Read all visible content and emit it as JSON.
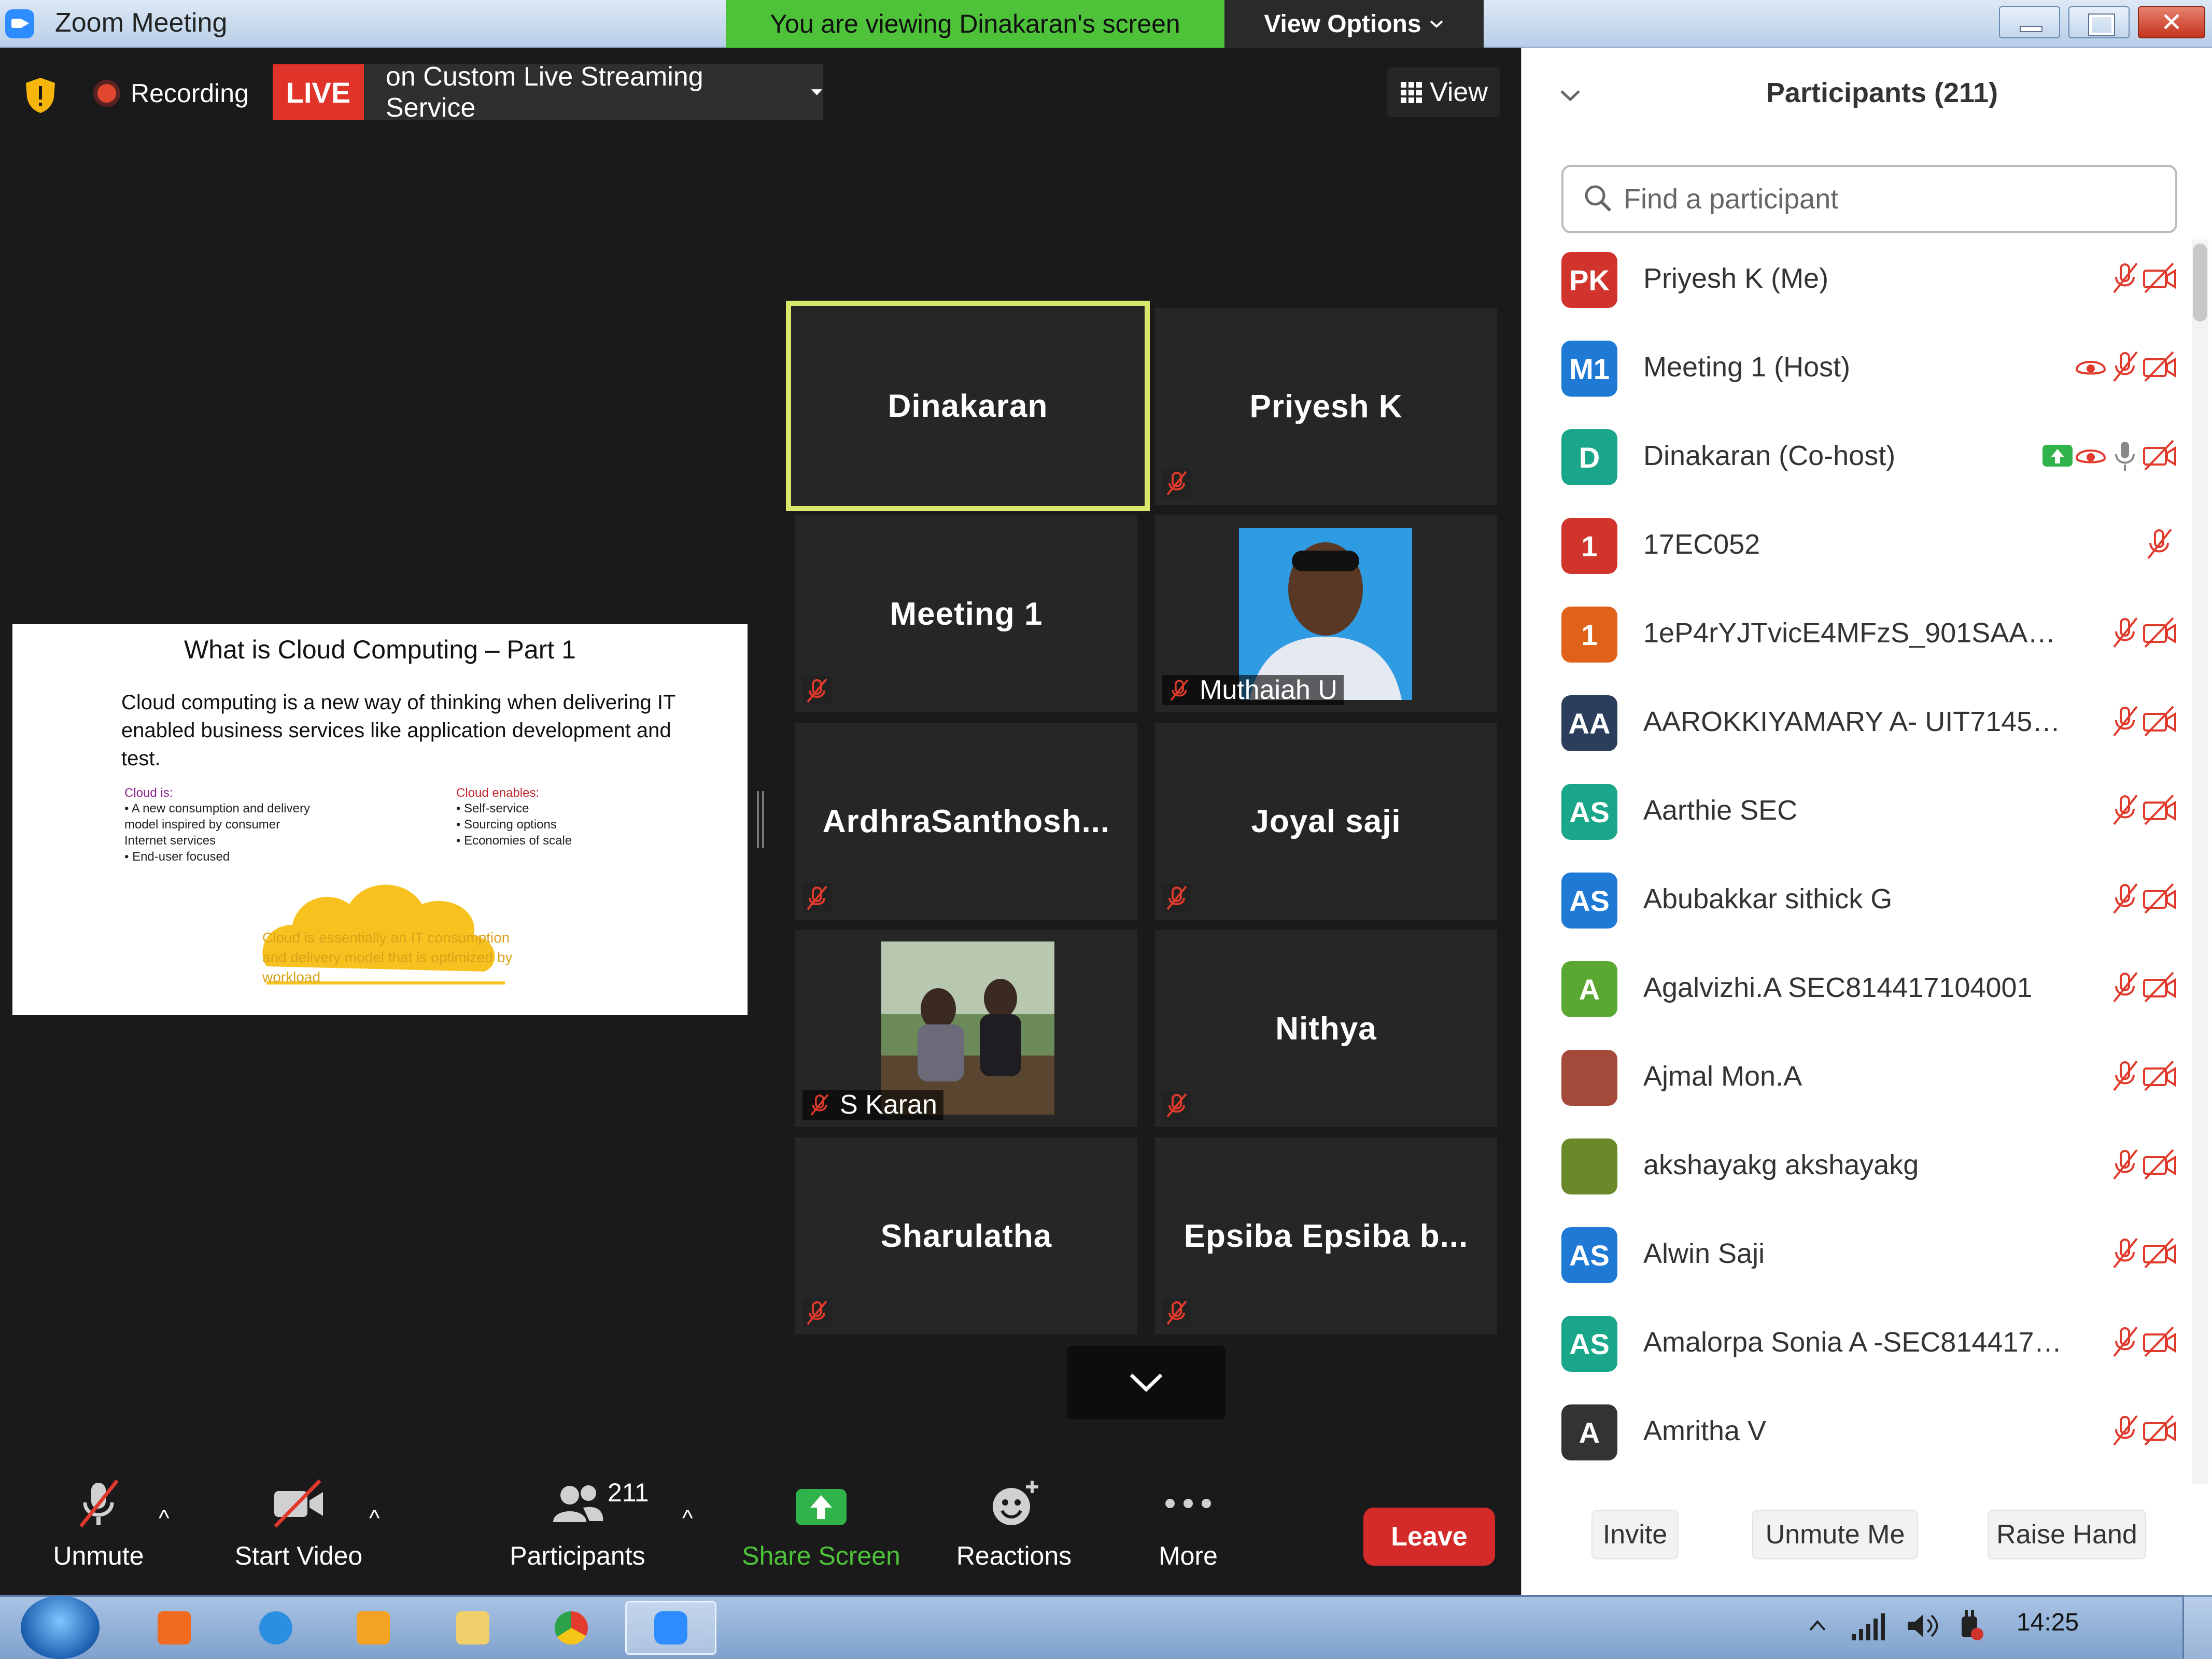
{
  "window": {
    "title": "Zoom Meeting"
  },
  "banner": {
    "viewing_text": "You are viewing Dinakaran's screen",
    "view_options": "View Options"
  },
  "meeting_top": {
    "recording_label": "Recording",
    "live_badge": "LIVE",
    "stream_service": "on Custom Live Streaming Service",
    "view_label": "View"
  },
  "shared_slide": {
    "title": "What is Cloud Computing – Part 1",
    "body": "Cloud computing is a new way of thinking when delivering IT enabled business services like application development and test.",
    "left_heading": "Cloud is:",
    "left_items": [
      "A new consumption and delivery model inspired by consumer Internet services",
      "End-user focused"
    ],
    "right_heading": "Cloud enables:",
    "right_items": [
      "Self-service",
      "Sourcing options",
      "Economies of scale"
    ],
    "cloud_caption": "Cloud is essentially an IT consumption and delivery model that is optimized by workload"
  },
  "gallery": {
    "tiles": [
      {
        "name": "Dinakaran",
        "active_speaker": true,
        "muted": false
      },
      {
        "name": "Priyesh K",
        "muted": true
      },
      {
        "name": "Meeting 1",
        "muted": true
      },
      {
        "name": "Muthaiah U",
        "muted": true,
        "video": true
      },
      {
        "name": "ArdhraSanthosh...",
        "muted": true
      },
      {
        "name": "Joyal saji",
        "muted": true
      },
      {
        "name": "S Karan",
        "muted": true,
        "video": true
      },
      {
        "name": "Nithya",
        "muted": true
      },
      {
        "name": "Sharulatha",
        "muted": true
      },
      {
        "name": "Epsiba  Epsiba  b...",
        "muted": true
      }
    ]
  },
  "toolbar": {
    "unmute": "Unmute",
    "start_video": "Start Video",
    "participants": "Participants",
    "participant_count": "211",
    "share_screen": "Share Screen",
    "reactions": "Reactions",
    "more": "More",
    "leave": "Leave"
  },
  "panel": {
    "title": "Participants (211)",
    "search_placeholder": "Find a participant",
    "participants": [
      {
        "initials": "PK",
        "name": "Priyesh K (Me)",
        "color": "#d0342c"
      },
      {
        "initials": "M1",
        "name": "Meeting 1 (Host)",
        "color": "#1f7ad6"
      },
      {
        "initials": "D",
        "name": "Dinakaran (Co-host)",
        "color": "#1aa68a"
      },
      {
        "initials": "1",
        "name": "17EC052",
        "color": "#d0342c"
      },
      {
        "initials": "1",
        "name": "1eP4rYJTvicE4MFzS_901SAAAAA...",
        "color": "#e0611a"
      },
      {
        "initials": "AA",
        "name": "AAROKKIYAMARY A- UIT714517...",
        "color": "#2b3f5c"
      },
      {
        "initials": "AS",
        "name": "Aarthie SEC",
        "color": "#1aa68a"
      },
      {
        "initials": "AS",
        "name": "Abubakkar sithick G",
        "color": "#1f7ad6"
      },
      {
        "initials": "A",
        "name": "Agalvizhi.A SEC814417104001",
        "color": "#5aa832"
      },
      {
        "initials": "",
        "name": "Ajmal Mon.A",
        "color": "#a44a3a"
      },
      {
        "initials": "",
        "name": "akshayakg akshayakg",
        "color": "#6a8a2a"
      },
      {
        "initials": "AS",
        "name": "Alwin Saji",
        "color": "#1f7ad6"
      },
      {
        "initials": "AS",
        "name": "Amalorpa Sonia A -SEC8144171...",
        "color": "#1aa68a"
      },
      {
        "initials": "A",
        "name": "Amritha V",
        "color": "#333333"
      }
    ],
    "invite": "Invite",
    "unmute_me": "Unmute Me",
    "raise_hand": "Raise Hand"
  },
  "taskbar": {
    "clock": "14:25"
  }
}
